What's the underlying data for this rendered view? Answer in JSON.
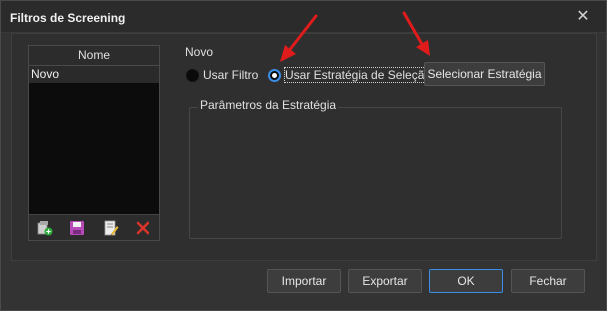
{
  "window": {
    "title": "Filtros de Screening",
    "close_glyph": "✕"
  },
  "list": {
    "header": "Nome",
    "items": [
      "Novo"
    ],
    "toolbar_icons": [
      "add-icon",
      "save-icon",
      "edit-icon",
      "delete-icon"
    ]
  },
  "form": {
    "name_label": "Novo",
    "radio_filter_label": "Usar Filtro",
    "radio_strategy_label": "Usar Estratégia de Seleção",
    "selected_option": "Usar Estratégia de Seleção",
    "select_strategy_button": "Selecionar Estratégia",
    "strategy_params_title": "Parâmetros da Estratégia"
  },
  "footer": {
    "import_label": "Importar",
    "export_label": "Exportar",
    "ok_label": "OK",
    "close_label": "Fechar"
  },
  "colors": {
    "accent": "#3a8ee6",
    "annotation_arrow": "#e01b1b",
    "delete_red": "#d9342b"
  }
}
